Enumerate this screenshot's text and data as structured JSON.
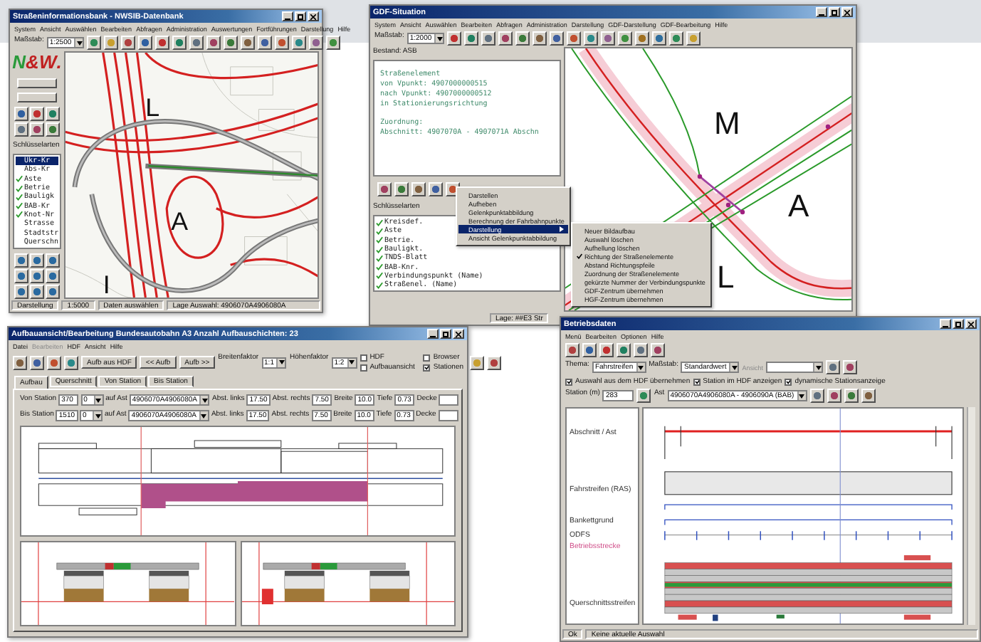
{
  "map_window": {
    "title": "Straßeninformationsbank - NWSIB-Datenbank",
    "menu": [
      "System",
      "Ansicht",
      "Auswählen",
      "Bearbeiten",
      "Abfragen",
      "Administration",
      "Auswertungen",
      "Fortführungen",
      "Darstellung",
      "Hilfe"
    ],
    "scale_label": "Maßstab:",
    "scale": "1:2500",
    "logo": [
      "N",
      "&",
      "W",
      "."
    ],
    "key_title": "Schlüsselarten",
    "keys": [
      {
        "label": "Ukr-Kr",
        "checked": false,
        "selected": true
      },
      {
        "label": "Abs-Kr",
        "checked": false,
        "selected": false
      },
      {
        "label": "Aste",
        "checked": true,
        "selected": false
      },
      {
        "label": "Betrie",
        "checked": true,
        "selected": false
      },
      {
        "label": "Bauligk",
        "checked": true,
        "selected": false
      },
      {
        "label": "BAB-Kr",
        "checked": true,
        "selected": false
      },
      {
        "label": "Knot-Nr",
        "checked": true,
        "selected": false
      },
      {
        "label": "Strasse",
        "checked": false,
        "selected": false
      },
      {
        "label": "Stadtstr",
        "checked": false,
        "selected": false
      },
      {
        "label": "Querschn",
        "checked": false,
        "selected": false
      }
    ],
    "map_labels": [
      "L",
      "A",
      "I"
    ],
    "status": [
      "Darstellung",
      "1:5000",
      "Daten auswählen",
      "Lage Auswahl: 4906070A4906080A"
    ]
  },
  "gdf_window": {
    "title": "GDF-Situation",
    "menu": [
      "System",
      "Ansicht",
      "Auswählen",
      "Bearbeiten",
      "Abfragen",
      "Administration",
      "Darstellung",
      "GDF-Darstellung",
      "GDF-Bearbeitung",
      "Hilfe"
    ],
    "scale_label": "Maßstab:",
    "scale": "1:2000",
    "stock": "Bestand: ASB",
    "info_groups": [
      [
        "Straßenelement",
        "von Vpunkt: 4907000000515",
        "nach Vpunkt: 4907000000512",
        "in Stationierungsrichtung"
      ],
      [
        "Zuordnung:",
        "Abschnitt: 4907070A - 4907071A Abschn"
      ]
    ],
    "key_title": "Schlüsselarten",
    "keys": [
      {
        "label": "Kreisdef.",
        "checked": true
      },
      {
        "label": "Aste",
        "checked": true
      },
      {
        "label": "Betrie.",
        "checked": true
      },
      {
        "label": "Bauligkt.",
        "checked": true
      },
      {
        "label": "TNDS-Blatt",
        "checked": true
      },
      {
        "label": "BAB-Knr.",
        "checked": true
      },
      {
        "label": "Verbindungspunkt (Name)",
        "checked": true
      },
      {
        "label": "Straßenel. (Name)",
        "checked": true
      }
    ],
    "map_labels": [
      "M",
      "A",
      "L"
    ],
    "status": "Lage: ##E3 Str",
    "context_menu": [
      {
        "label": "Darstellen",
        "selected": false,
        "has_submenu": false
      },
      {
        "label": "Aufheben",
        "selected": false,
        "has_submenu": false
      },
      {
        "label": "Gelenkpunktabbildung",
        "selected": false,
        "has_submenu": false
      },
      {
        "label": "Berechnung der Fahrbahnpunkte",
        "selected": false,
        "has_submenu": false
      },
      {
        "label": "Darstellung",
        "selected": true,
        "has_submenu": true
      },
      {
        "label": "Ansicht Gelenkpunktabbildung",
        "selected": false,
        "has_submenu": false
      }
    ],
    "submenu": [
      {
        "label": "Neuer Bildaufbau",
        "checked": false
      },
      {
        "label": "Auswahl löschen",
        "checked": false
      },
      {
        "label": "Aufhellung löschen",
        "checked": false
      },
      {
        "label": "Richtung der Straßenelemente",
        "checked": true
      },
      {
        "label": "Abstand Richtungspfeile",
        "checked": false
      },
      {
        "label": "Zuordnung der Straßenelemente",
        "checked": false
      },
      {
        "label": "gekürzte Nummer der Verbindungspunkte",
        "checked": false
      },
      {
        "label": "GDF-Zentrum übernehmen",
        "checked": false
      },
      {
        "label": "HGF-Zentrum übernehmen",
        "checked": false
      }
    ]
  },
  "layer_window": {
    "title": "Aufbauansicht/Bearbeitung Bundesautobahn A3 Anzahl Aufbauschichten: 23",
    "menu": [
      {
        "label": "Datei",
        "disabled": false
      },
      {
        "label": "Bearbeiten",
        "disabled": true
      },
      {
        "label": "HDF",
        "disabled": false
      },
      {
        "label": "Ansicht",
        "disabled": false
      },
      {
        "label": "Hilfe",
        "disabled": false
      }
    ],
    "buttons": [
      "Aufb aus HDF",
      "<< Aufb",
      "Aufb >>"
    ],
    "factors": [
      {
        "label": "Breitenfaktor",
        "value": "1:1"
      },
      {
        "label": "Höhenfaktor",
        "value": "1:2"
      }
    ],
    "options": [
      {
        "label": "HDF",
        "checked": false
      },
      {
        "label": "Browser",
        "checked": false
      },
      {
        "label": "Aufbauansicht",
        "checked": false
      },
      {
        "label": "Stationen",
        "checked": true
      }
    ],
    "tabs": [
      {
        "label": "Aufbau",
        "selected": true
      },
      {
        "label": "Querschnitt",
        "selected": false
      },
      {
        "label": "Von Station",
        "selected": false
      },
      {
        "label": "Bis Station",
        "selected": false
      }
    ],
    "rows": [
      [
        {
          "kind": "label",
          "text": "Von Station"
        },
        {
          "kind": "field",
          "text": "370"
        },
        {
          "kind": "select",
          "text": "0"
        },
        {
          "kind": "label",
          "text": "auf Ast"
        },
        {
          "kind": "select",
          "text": "4906070A4906080A"
        },
        {
          "kind": "label",
          "text": "Abst. links"
        },
        {
          "kind": "field",
          "text": "17.50"
        },
        {
          "kind": "label",
          "text": "Abst. rechts"
        },
        {
          "kind": "field",
          "text": "7.50"
        },
        {
          "kind": "label",
          "text": "Breite"
        },
        {
          "kind": "field",
          "text": "10.0"
        },
        {
          "kind": "label",
          "text": "Tiefe"
        },
        {
          "kind": "field",
          "text": "0.73"
        },
        {
          "kind": "label",
          "text": "Decke"
        },
        {
          "kind": "field",
          "text": ""
        }
      ],
      [
        {
          "kind": "label",
          "text": "Bis Station"
        },
        {
          "kind": "field",
          "text": "1510"
        },
        {
          "kind": "select",
          "text": "0"
        },
        {
          "kind": "label",
          "text": "auf Ast"
        },
        {
          "kind": "select",
          "text": "4906070A4906080A"
        },
        {
          "kind": "label",
          "text": "Abst. links"
        },
        {
          "kind": "field",
          "text": "17.50"
        },
        {
          "kind": "label",
          "text": "Abst. rechts"
        },
        {
          "kind": "field",
          "text": "7.50"
        },
        {
          "kind": "label",
          "text": "Breite"
        },
        {
          "kind": "field",
          "text": "10.0"
        },
        {
          "kind": "label",
          "text": "Tiefe"
        },
        {
          "kind": "field",
          "text": "0.73"
        },
        {
          "kind": "label",
          "text": "Decke"
        },
        {
          "kind": "field",
          "text": ""
        }
      ]
    ]
  },
  "station_window": {
    "title": "Betriebsdaten",
    "menu": [
      "Menü",
      "Bearbeiten",
      "Optionen",
      "Hilfe"
    ],
    "theme_label": "Thema:",
    "theme": "Fahrstreifen",
    "scale_label": "Maßstab:",
    "scale": "Standardwert",
    "view_label": "Ansicht",
    "options": [
      {
        "label": "Auswahl aus dem HDF übernehmen",
        "checked": true
      },
      {
        "label": "Station im HDF anzeigen",
        "checked": true
      },
      {
        "label": "dynamische Stationsanzeige",
        "checked": true
      }
    ],
    "station_label": "Station (m)",
    "station": "283",
    "axis_label": "Ast",
    "axis": "4906070A4906080A - 4906090A (BAB)",
    "tracks": [
      {
        "label": "Abschnitt / Ast"
      },
      {
        "label": "Fahrstreifen (RAS)"
      },
      {
        "label": "Bankettgrund"
      },
      {
        "label": "ODFS"
      },
      {
        "label": "Betriebsstrecke",
        "color": "#d0508a"
      },
      {
        "label": "Querschnittsstreifen"
      }
    ],
    "status": [
      "Ok",
      "Keine aktuelle Auswahl"
    ]
  }
}
